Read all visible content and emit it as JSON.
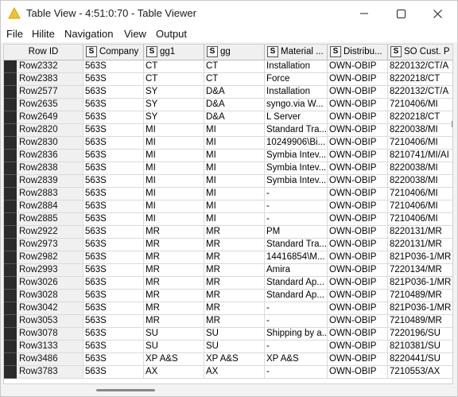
{
  "window": {
    "title": "Table View - 4:51:0:70 - Table Viewer"
  },
  "menu": [
    "File",
    "Hilite",
    "Navigation",
    "View",
    "Output"
  ],
  "columns": [
    {
      "label": "Row ID",
      "type": ""
    },
    {
      "label": "Company",
      "type": "S"
    },
    {
      "label": "gg1",
      "type": "S"
    },
    {
      "label": "gg",
      "type": "S"
    },
    {
      "label": "Material ...",
      "type": "S"
    },
    {
      "label": "Distribu...",
      "type": "S"
    },
    {
      "label": "SO Cust. P",
      "type": "S"
    }
  ],
  "rows": [
    [
      "Row2332",
      "563S",
      "CT",
      "CT",
      "Installation",
      "OWN-OBIP",
      "8220132/CT/A"
    ],
    [
      "Row2383",
      "563S",
      "CT",
      "CT",
      "Force",
      "OWN-OBIP",
      "8220218/CT"
    ],
    [
      "Row2577",
      "563S",
      "SY",
      "D&A",
      "Installation",
      "OWN-OBIP",
      "8220132/CT/A"
    ],
    [
      "Row2635",
      "563S",
      "SY",
      "D&A",
      "syngo.via W...",
      "OWN-OBIP",
      "7210406/MI"
    ],
    [
      "Row2649",
      "563S",
      "SY",
      "D&A",
      "L Server",
      "OWN-OBIP",
      "8220218/CT"
    ],
    [
      "Row2820",
      "563S",
      "MI",
      "MI",
      "Standard Tra...",
      "OWN-OBIP",
      "8220038/MI"
    ],
    [
      "Row2830",
      "563S",
      "MI",
      "MI",
      "10249906\\Bi...",
      "OWN-OBIP",
      "7210406/MI"
    ],
    [
      "Row2836",
      "563S",
      "MI",
      "MI",
      "Symbia Intev...",
      "OWN-OBIP",
      "8210741/MI/AI"
    ],
    [
      "Row2838",
      "563S",
      "MI",
      "MI",
      "Symbia Intev...",
      "OWN-OBIP",
      "8220038/MI"
    ],
    [
      "Row2839",
      "563S",
      "MI",
      "MI",
      "Symbia Intev...",
      "OWN-OBIP",
      "8220038/MI"
    ],
    [
      "Row2883",
      "563S",
      "MI",
      "MI",
      "-",
      "OWN-OBIP",
      "7210406/MI"
    ],
    [
      "Row2884",
      "563S",
      "MI",
      "MI",
      "-",
      "OWN-OBIP",
      "7210406/MI"
    ],
    [
      "Row2885",
      "563S",
      "MI",
      "MI",
      "-",
      "OWN-OBIP",
      "7210406/MI"
    ],
    [
      "Row2922",
      "563S",
      "MR",
      "MR",
      "PM",
      "OWN-OBIP",
      "8220131/MR"
    ],
    [
      "Row2973",
      "563S",
      "MR",
      "MR",
      "Standard Tra...",
      "OWN-OBIP",
      "8220131/MR"
    ],
    [
      "Row2982",
      "563S",
      "MR",
      "MR",
      "14416854\\M...",
      "OWN-OBIP",
      "821P036-1/MR"
    ],
    [
      "Row2993",
      "563S",
      "MR",
      "MR",
      "Amira",
      "OWN-OBIP",
      "7220134/MR"
    ],
    [
      "Row3026",
      "563S",
      "MR",
      "MR",
      "Standard Ap...",
      "OWN-OBIP",
      "821P036-1/MR"
    ],
    [
      "Row3028",
      "563S",
      "MR",
      "MR",
      "Standard Ap...",
      "OWN-OBIP",
      "7210489/MR"
    ],
    [
      "Row3042",
      "563S",
      "MR",
      "MR",
      "-",
      "OWN-OBIP",
      "821P036-1/MR"
    ],
    [
      "Row3053",
      "563S",
      "MR",
      "MR",
      "-",
      "OWN-OBIP",
      "7210489/MR"
    ],
    [
      "Row3078",
      "563S",
      "SU",
      "SU",
      "Shipping by a...",
      "OWN-OBIP",
      "7220196/SU"
    ],
    [
      "Row3133",
      "563S",
      "SU",
      "SU",
      "-",
      "OWN-OBIP",
      "8210381/SU"
    ],
    [
      "Row3486",
      "563S",
      "XP A&S",
      "XP A&S",
      "XP A&S",
      "OWN-OBIP",
      "8220441/SU"
    ],
    [
      "Row3783",
      "563S",
      "AX",
      "AX",
      "-",
      "OWN-OBIP",
      "7210553/AX"
    ]
  ],
  "colors": {
    "row_marker": "#2b2b2b",
    "header_bg": "#f0f0f0",
    "app_icon": "#f2c12e"
  }
}
